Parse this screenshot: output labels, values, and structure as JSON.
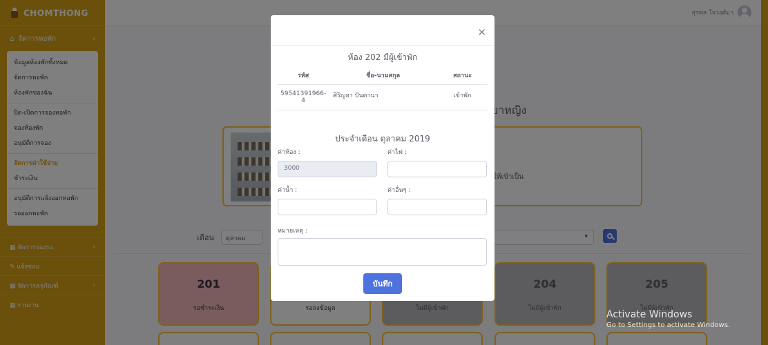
{
  "brand": "CHOMTHONG",
  "user": {
    "name": "สุรพล ใจวงศ์มา"
  },
  "sidebar": {
    "section1": "จัดการหอพัก",
    "items": [
      "ข้อมูลห้องพักทั้งหมด",
      "จัดการหอพัก",
      "ห้องพักของฉัน",
      "ปิด-เปิดการจองหอพัก",
      "จองห้องพัก",
      "อนุมัติการจอง",
      "จัดการค่าใช้จ่าย",
      "ชำระเงิน",
      "อนุมัติการแจ้งออกหอพัก",
      "รอออกหอพัก"
    ],
    "section2": "จัดการรองรอ",
    "section3": "แจ้งซ่อม",
    "section4": "จัดการครุภัณฑ์",
    "section5": "รายงาน"
  },
  "main": {
    "heading": "ยาหญิง",
    "card_text": "ให้เข้าเป็น",
    "month_label": "เดือน",
    "month_value": "ตุลาคม",
    "tiles": [
      {
        "room": "201",
        "status": "รอชำระเงิน"
      },
      {
        "room": "202",
        "status": "รอลงข้อมูล"
      },
      {
        "room": "203",
        "status": "ไม่มีผู้เข้าพัก"
      },
      {
        "room": "204",
        "status": "ไม่มีผู้เข้าพัก"
      },
      {
        "room": "205",
        "status": "ไม่มีผู้เข้าพัก"
      }
    ]
  },
  "modal": {
    "title": "ห้อง 202 มีผู้เข้าพัก",
    "columns": [
      "รหัส",
      "ชื่อ-นามสกุล",
      "สถานะ"
    ],
    "row": {
      "id": "59541391966-4",
      "name": "ศิริญยา ปันตานา",
      "status": "เข้าพัก"
    },
    "subtitle": "ประจำเดือน ตุลาคม 2019",
    "room_fee_label": "ค่าห้อง :",
    "room_fee_value": "3000",
    "electric_label": "ค่าไฟ :",
    "water_label": "ค่าน้ำ :",
    "other_label": "ค่าอื่นๆ :",
    "note_label": "หมายเหตุ :",
    "save_label": "บันทึก"
  },
  "watermark": {
    "line1": "Activate Windows",
    "line2": "Go to Settings to activate Windows."
  }
}
